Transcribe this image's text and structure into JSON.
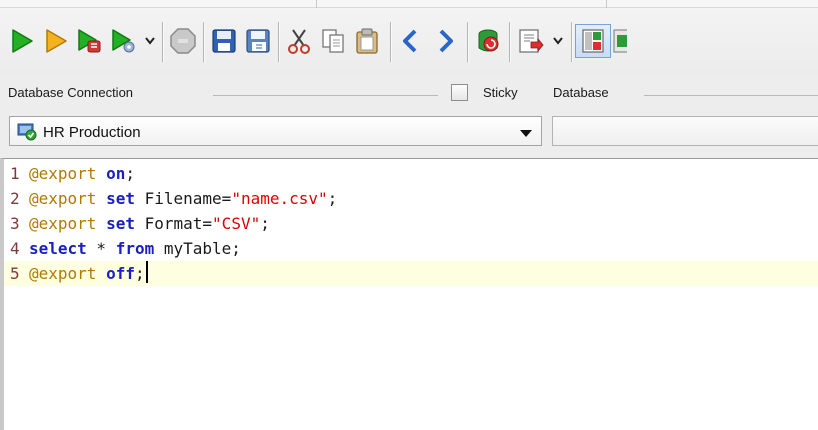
{
  "toolbar": {
    "buttons": [
      {
        "name": "execute-icon",
        "color": "#21a321"
      },
      {
        "name": "execute-current-icon",
        "color": "#f3a014"
      },
      {
        "name": "execute-explain-icon",
        "color": "#21a321"
      },
      {
        "name": "execute-options-icon",
        "color": "#21a321"
      },
      {
        "name": "stop-icon",
        "color": "#9b9b9b"
      },
      {
        "name": "save-icon",
        "color": "#2f5fa8"
      },
      {
        "name": "save-as-icon",
        "color": "#4f7fb8"
      },
      {
        "name": "cut-icon"
      },
      {
        "name": "copy-icon"
      },
      {
        "name": "paste-icon"
      },
      {
        "name": "back-icon",
        "color": "#2a66c9"
      },
      {
        "name": "forward-icon",
        "color": "#2a66c9"
      },
      {
        "name": "database-refresh-icon",
        "color": "#cc2b2b"
      },
      {
        "name": "result-export-icon",
        "color": "#cc2b2b"
      },
      {
        "name": "panel-layout-icon",
        "color": "#cc2b2b"
      }
    ]
  },
  "connection": {
    "group_label": "Database Connection",
    "sticky_label": "Sticky",
    "sticky_checked": false,
    "database_label": "Database",
    "selected_connection": "HR Production",
    "connection_icon": "database-connection-icon"
  },
  "editor": {
    "lines": [
      {
        "num": "1",
        "tokens": [
          {
            "t": "@export",
            "c": "dir"
          },
          {
            "t": " ",
            "c": "id"
          },
          {
            "t": "on",
            "c": "kw"
          },
          {
            "t": ";",
            "c": "id"
          }
        ]
      },
      {
        "num": "2",
        "tokens": [
          {
            "t": "@export",
            "c": "dir"
          },
          {
            "t": " ",
            "c": "id"
          },
          {
            "t": "set",
            "c": "kw"
          },
          {
            "t": " Filename=",
            "c": "id"
          },
          {
            "t": "\"name.csv\"",
            "c": "str"
          },
          {
            "t": ";",
            "c": "id"
          }
        ]
      },
      {
        "num": "3",
        "tokens": [
          {
            "t": "@export",
            "c": "dir"
          },
          {
            "t": " ",
            "c": "id"
          },
          {
            "t": "set",
            "c": "kw"
          },
          {
            "t": " Format=",
            "c": "id"
          },
          {
            "t": "\"CSV\"",
            "c": "str"
          },
          {
            "t": ";",
            "c": "id"
          }
        ]
      },
      {
        "num": "4",
        "tokens": [
          {
            "t": "select",
            "c": "kw"
          },
          {
            "t": " * ",
            "c": "id"
          },
          {
            "t": "from",
            "c": "kw"
          },
          {
            "t": " myTable;",
            "c": "id"
          }
        ]
      },
      {
        "num": "5",
        "tokens": [
          {
            "t": "@export",
            "c": "dir"
          },
          {
            "t": " ",
            "c": "id"
          },
          {
            "t": "off",
            "c": "kw"
          },
          {
            "t": ";",
            "c": "id"
          }
        ]
      }
    ],
    "current_line": 5
  }
}
